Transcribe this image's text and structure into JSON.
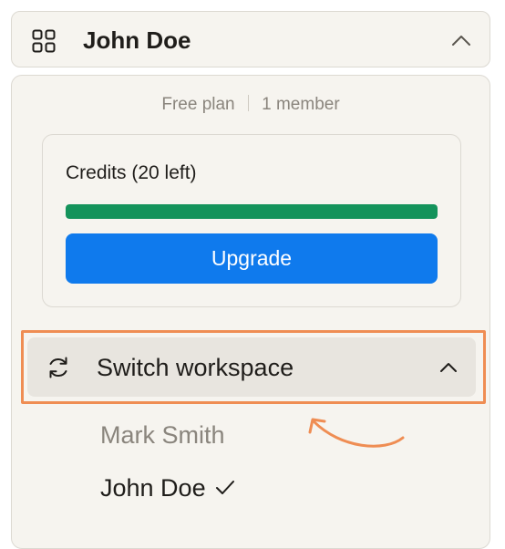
{
  "header": {
    "workspace_name": "John Doe",
    "icon": "grid-icon",
    "toggle_icon": "chevron-up-icon"
  },
  "plan": {
    "plan_name": "Free plan",
    "members": "1 member"
  },
  "credits": {
    "title": "Credits (20 left)",
    "remaining_fraction": 1.0,
    "bar_color": "#14935b",
    "upgrade_label": "Upgrade",
    "upgrade_color": "#0f7aed"
  },
  "switch_workspace": {
    "label": "Switch workspace",
    "icon": "refresh-icon",
    "toggle_icon": "chevron-up-icon",
    "highlight_color": "#ef8d53"
  },
  "workspaces": [
    {
      "name": "Mark Smith",
      "selected": false
    },
    {
      "name": "John Doe",
      "selected": true
    }
  ]
}
